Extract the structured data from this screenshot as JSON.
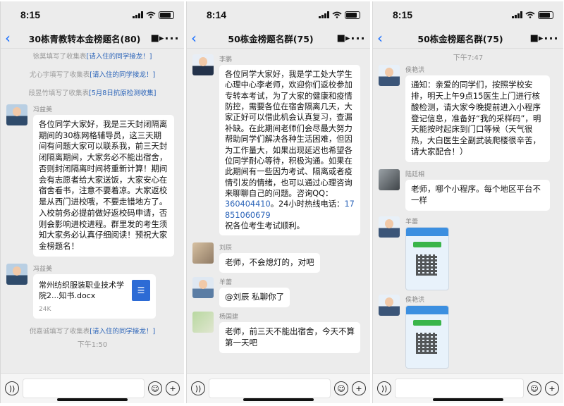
{
  "phones": [
    {
      "time": "8:15",
      "title": "30栋青教转本金榜题名(80)",
      "messages": {
        "sys1_prefix": "徐莫填写了收集表",
        "sys1_link": "[请入住的同学接龙！]",
        "sys2_prefix": "尤心宇填写了收集表",
        "sys2_link": "[请入住的同学接龙！]",
        "sys3_prefix": "段昱竹填写了收集表",
        "sys3_link": "[5月8日抗原检测收集]",
        "m1_name": "冯益美",
        "m1_text": "各位同学大家好，我是三天封闭隔离期间的30栋网格辅导员，这三天期间有问题大家可以联系我，前三天封闭隔离期间，大家务必不能出宿舍，否则封闭隔离时间将重新计算！期间会有志愿者给大家送饭，大家安心在宿舍看书，注意不要着凉。大家返校是从西门进校哦，不要走错地方了。入校前务必提前做好返校码申请，否则会影响进校进程。群里发的考生须知大家务必认真仔细阅读！预祝大家金榜题名！",
        "m2_name": "冯益美",
        "m2_file": "常州纺织服装职业技术学院2...知书.docx",
        "m2_size": "24K",
        "sys4_prefix": "倪嘉诚填写了收集表",
        "sys4_link": "[请入住的同学接龙！]",
        "time1": "下午1:50"
      }
    },
    {
      "time": "8:14",
      "title": "50栋金榜题名群(75)",
      "messages": {
        "m1_name": "李鹏",
        "m1_text_a": "各位同学大家好，我是学工处大学生心理中心李老师，欢迎你们返校参加专转本考试，为了大家的健康和疫情防控，需要各位在宿舍隔离几天，大家正好可以借此机会认真复习，查漏补缺。在此期间老师们会尽最大努力帮助同学们解决各种生活困难，但因为工作量大，如果出现延迟也希望各位同学耐心等待，积极沟通。如果在此期间有一些因为考试、隔离或者疫情引发的情绪，也可以通过心理咨询来聊聊自己的问题。咨询QQ：",
        "m1_qq": "360404410",
        "m1_text_b": "。24小时热线电话：",
        "m1_phone": "17851060679",
        "m1_text_c": "祝各位考生考试顺利。",
        "m2_name": "刘辰",
        "m2_text": "老师，不会熄灯的，对吧",
        "m3_name": "羊蕾",
        "m3_text": "@刘辰 私聊你了",
        "m4_name": "杨国建",
        "m4_text": "老师，前三天不能出宿舍，今天不算第一天吧"
      }
    },
    {
      "time": "8:15",
      "title": "50栋金榜题名群(75)",
      "messages": {
        "time1": "下午7:47",
        "m1_name": "侯艳洪",
        "m1_text": "通知：亲爱的同学们，按照学校安排，明天上午9点15医生上门进行核酸检测，请大家今晚提前进入小程序登记信息，准备好“我的采样码”，明天能按时起床到门口等候（天气很热，大白医生全副武装爬楼很辛苦，请大家配合！）",
        "m2_name": "陆廷相",
        "m2_text": "老师，哪个小程序。每个地区平台不一样",
        "m3_name": "羊蕾",
        "m4_name": "侯艳洪"
      }
    }
  ],
  "icons": {
    "back": "chevron-left-icon",
    "video": "video-call-icon",
    "more": "more-icon",
    "voice": "voice-icon",
    "emoji": "emoji-icon",
    "plus": "plus-icon"
  }
}
